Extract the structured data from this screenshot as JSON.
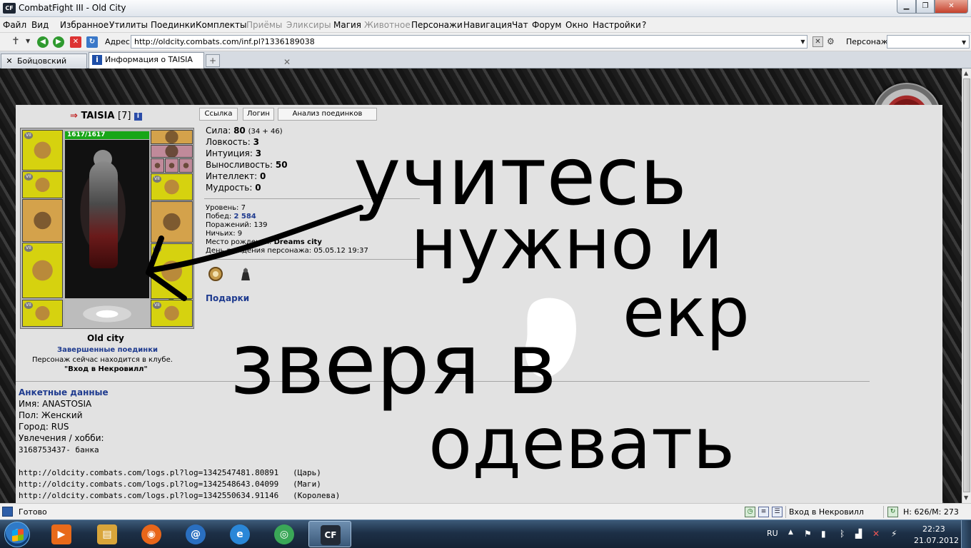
{
  "window": {
    "title": "CombatFight III - Old City",
    "app_icon_text": "CF",
    "min_label": "▁",
    "max_label": "❐",
    "close_label": "✕"
  },
  "menu": {
    "items": [
      {
        "label": "Файл",
        "disabled": false
      },
      {
        "label": "Вид",
        "disabled": false
      },
      {
        "label": "Избранное",
        "disabled": false
      },
      {
        "label": "Утилиты",
        "disabled": false
      },
      {
        "label": "Поединки",
        "disabled": false
      },
      {
        "label": "Комплекты",
        "disabled": false
      },
      {
        "label": "Приёмы",
        "disabled": true
      },
      {
        "label": "Эликсиры",
        "disabled": true
      },
      {
        "label": "Магия",
        "disabled": false
      },
      {
        "label": "Животное",
        "disabled": true
      },
      {
        "label": "Персонажи",
        "disabled": false
      },
      {
        "label": "Навигация",
        "disabled": false
      },
      {
        "label": "Чат",
        "disabled": false
      },
      {
        "label": "Форум",
        "disabled": false
      },
      {
        "label": "Окно",
        "disabled": false
      },
      {
        "label": "Настройки",
        "disabled": false
      },
      {
        "label": "?",
        "disabled": false
      }
    ]
  },
  "address": {
    "label": "Адрес:",
    "url": "http://oldcity.combats.com/inf.pl?1336189038",
    "character_label": "Персонаж:",
    "character_value": ""
  },
  "tabs": [
    {
      "label": "Бойцовский клуб",
      "icon": "crossed-swords-icon",
      "active": false
    },
    {
      "label": "Информация о TAISIA",
      "icon": "info-icon",
      "active": true
    }
  ],
  "tab_close_glyph": "✕",
  "tab_new_glyph": "+",
  "colors": {
    "link_blue": "#1f3b8f",
    "hp_green": "#18a618",
    "panel_bg": "#e2e2e2",
    "taskbar": "#1d3047"
  },
  "character": {
    "name": "TAISIA",
    "level_tag": "[7]",
    "info_glyph": "i",
    "hp": "1617/1617",
    "city": "Old city",
    "fights_link": "Завершенные поединки",
    "club_status": "Персонаж сейчас находится в клубе.",
    "club_location": "\"Вход в Некровилл\""
  },
  "buttons": {
    "link": "Ссылка",
    "login": "Логин",
    "analysis": "Анализ поединков"
  },
  "stats": [
    {
      "label": "Сила:",
      "value": "80",
      "extra": "(34 + 46)"
    },
    {
      "label": "Ловкость:",
      "value": "3",
      "extra": ""
    },
    {
      "label": "Интуиция:",
      "value": "3",
      "extra": ""
    },
    {
      "label": "Выносливость:",
      "value": "50",
      "extra": ""
    },
    {
      "label": "Интеллект:",
      "value": "0",
      "extra": ""
    },
    {
      "label": "Мудрость:",
      "value": "0",
      "extra": ""
    }
  ],
  "info": {
    "level": "Уровень: 7",
    "wins_label": "Побед:",
    "wins_value": "2 584",
    "losses": "Поражений: 139",
    "draws": "Ничьих: 9",
    "birthplace_label": "Место рождения:",
    "birthplace_value": "Dreams city",
    "birthday": "День рождения персонажа: 05.05.12 19:37"
  },
  "gifts_label": "Подарки",
  "profile": {
    "title": "Анкетные данные",
    "name": "Имя: ANASTOSIA",
    "gender": "Пол: Женский",
    "city": "Город: RUS",
    "hobby": "Увлечения / хобби:",
    "hobby_text": "3168753437- банка",
    "logs": [
      {
        "url": "http://oldcity.combats.com/logs.pl?log=1342547481.80891",
        "tag": "(Царь)"
      },
      {
        "url": "http://oldcity.combats.com/logs.pl?log=1342548643.04099",
        "tag": "(Маги)"
      },
      {
        "url": "http://oldcity.combats.com/logs.pl?log=1342550634.91146",
        "tag": "(Королева)"
      }
    ]
  },
  "handwriting": {
    "line1": "учитесь",
    "line2": "нужно и",
    "line3": "зверя в",
    "line4": "екр",
    "line5": "одевать"
  },
  "statusbar": {
    "status": "Готово",
    "location": "Вход в Некровилл",
    "hp": "Н: 626/М: 273"
  },
  "taskbar": {
    "apps": [
      {
        "name": "media-player",
        "glyph": "▶",
        "color": "#e86a1a",
        "active": false
      },
      {
        "name": "explorer",
        "glyph": "▤",
        "color": "#d9a53a",
        "active": false
      },
      {
        "name": "firefox",
        "glyph": "◉",
        "color": "#e8661a",
        "active": false
      },
      {
        "name": "email",
        "glyph": "@",
        "color": "#2a6fc0",
        "active": false
      },
      {
        "name": "ie",
        "glyph": "e",
        "color": "#2a87d8",
        "active": false
      },
      {
        "name": "chrome",
        "glyph": "◎",
        "color": "#3aa757",
        "active": false
      },
      {
        "name": "combatfight",
        "glyph": "CF",
        "color": "#222a36",
        "active": true
      }
    ],
    "lang": "RU",
    "time": "22:23",
    "date": "21.07.2012"
  }
}
